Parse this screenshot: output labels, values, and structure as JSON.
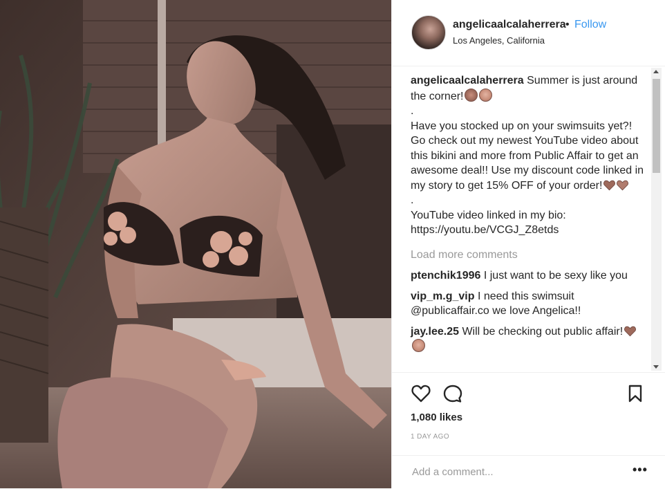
{
  "header": {
    "username": "angelicaalcalaherrera",
    "dot": "•",
    "follow_label": "Follow",
    "location": "Los Angeles, California"
  },
  "caption": {
    "username": "angelicaalcalaherrera",
    "line1": "Summer is just around the corner!",
    "sep1": ".",
    "body": "Have you stocked up on your swimsuits yet?! Go check out my newest YouTube video about this bikini and more from Public Affair to get an awesome deal!! Use my discount code linked in my story to get 15% OFF of your order!",
    "sep2": ".",
    "youtube_label": "YouTube video linked in my bio:",
    "youtube_url": "https://youtu.be/VCGJ_Z8etds"
  },
  "load_more": "Load more comments",
  "comments": [
    {
      "username": "ptenchik1996",
      "text": "I just want to be sexy like you"
    },
    {
      "username": "vip_m.g_vip",
      "text": "I need this swimsuit @publicaffair.co we love Angelica!!"
    },
    {
      "username": "jay.lee.25",
      "text": "Will be checking out public affair!"
    }
  ],
  "likes": "1,080 likes",
  "timestamp": "1 DAY AGO",
  "add_comment_placeholder": "Add a comment...",
  "more_options": "•••",
  "icons": {
    "like": "heart-outline-icon",
    "comment": "speech-bubble-icon",
    "save": "bookmark-icon",
    "more": "ellipsis-icon"
  },
  "colors": {
    "link": "#3897f0",
    "text": "#262626",
    "muted": "#999999",
    "border": "#efefef"
  }
}
